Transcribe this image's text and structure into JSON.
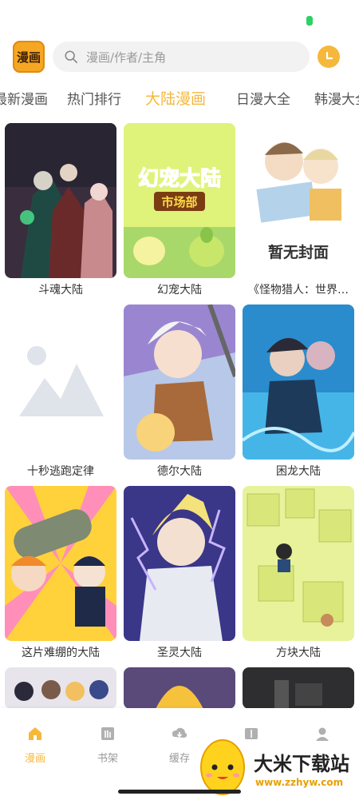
{
  "header": {
    "logo_text": "漫画",
    "search_placeholder": "漫画/作者/主角"
  },
  "tabs": [
    "最新漫画",
    "热门排行",
    "大陆漫画",
    "日漫大全",
    "韩漫大全"
  ],
  "active_tab": "大陆漫画",
  "comics": [
    {
      "title": "斗魂大陆"
    },
    {
      "title": "幻宠大陆",
      "cover_title": "幻宠大陆",
      "cover_subtitle": "市场部"
    },
    {
      "title": "《怪物猎人：世界…",
      "cover_text": "暂无封面"
    },
    {
      "title": "十秒逃跑定律"
    },
    {
      "title": "德尔大陆"
    },
    {
      "title": "困龙大陆"
    },
    {
      "title": "这片难绷的大陆"
    },
    {
      "title": "圣灵大陆"
    },
    {
      "title": "方块大陆"
    },
    {
      "title": ""
    },
    {
      "title": ""
    },
    {
      "title": ""
    }
  ],
  "nav": [
    {
      "label": "漫画",
      "icon": "home-icon"
    },
    {
      "label": "书架",
      "icon": "bookshelf-icon"
    },
    {
      "label": "缓存",
      "icon": "download-icon"
    },
    {
      "label": "",
      "icon": "category-icon"
    },
    {
      "label": "",
      "icon": "user-icon"
    }
  ],
  "watermark": {
    "title": "大米下载站",
    "url": "www.zzhyw.com"
  },
  "colors": {
    "accent": "#f5b83a",
    "status_battery": "#2fd066"
  }
}
